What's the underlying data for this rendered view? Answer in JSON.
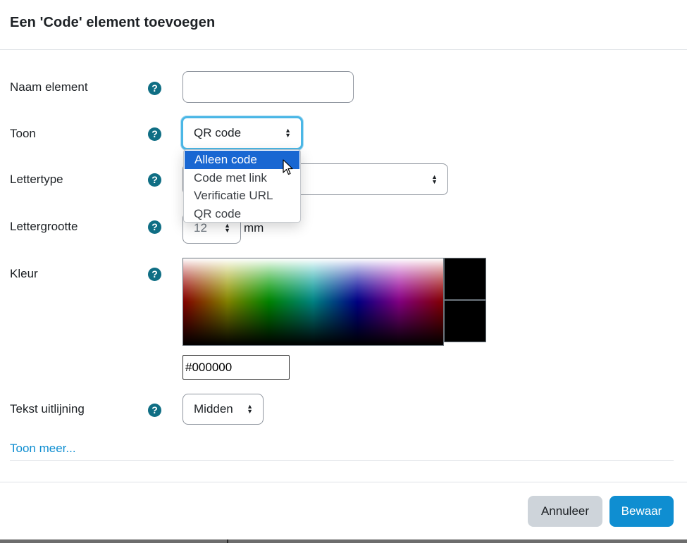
{
  "modal": {
    "title": "Een 'Code' element toevoegen"
  },
  "form": {
    "name_label": "Naam element",
    "name_value": "",
    "display_label": "Toon",
    "display_value": "QR code",
    "display_options": [
      "Alleen code",
      "Code met link",
      "Verificatie URL",
      "QR code"
    ],
    "display_highlighted": "Alleen code",
    "font_label": "Lettertype",
    "font_value": "",
    "fontsize_label": "Lettergrootte",
    "fontsize_value": "12",
    "fontsize_unit": "mm",
    "color_label": "Kleur",
    "color_value": "#000000",
    "align_label": "Tekst uitlijning",
    "align_value": "Midden",
    "help_glyph": "?",
    "show_more": "Toon meer..."
  },
  "footer": {
    "cancel_label": "Annuleer",
    "save_label": "Bewaar"
  },
  "colors": {
    "primary": "#0f8ed1",
    "help_icon": "#0f6e84",
    "focus_ring": "#4bb7e6",
    "option_highlight": "#1967d2",
    "secondary_button": "#ced4da"
  },
  "icons": {
    "help": "question-circle-icon",
    "select_arrows": "sort-arrows-icon",
    "cursor": "mouse-pointer-icon"
  }
}
